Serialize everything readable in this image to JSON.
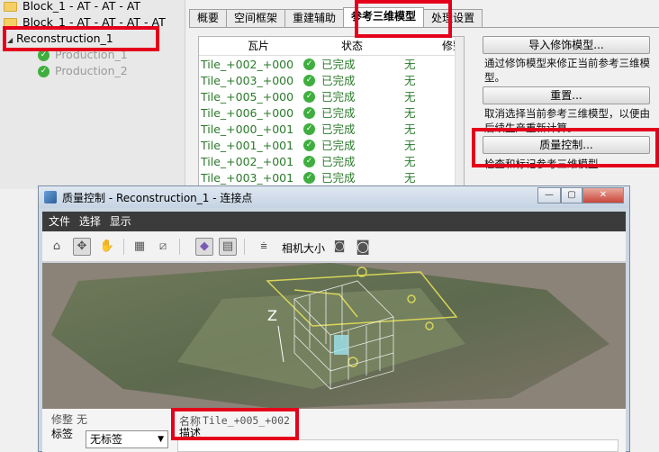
{
  "tree": {
    "items": [
      {
        "label": "Block_1 - AT - AT - AT"
      },
      {
        "label": "Block_1 - AT - AT - AT - AT"
      },
      {
        "label": "Reconstruction_1"
      },
      {
        "label": "Production_1"
      },
      {
        "label": "Production_2"
      }
    ]
  },
  "tabs": [
    {
      "label": "概要"
    },
    {
      "label": "空间框架"
    },
    {
      "label": "重建辅助"
    },
    {
      "label": "参考三维模型"
    },
    {
      "label": "处理设置"
    }
  ],
  "tiles": {
    "columns": [
      "瓦片",
      "状态",
      "修整"
    ],
    "rows": [
      {
        "tile": "Tile_+002_+000",
        "status": "已完成",
        "trim": "无"
      },
      {
        "tile": "Tile_+003_+000",
        "status": "已完成",
        "trim": "无"
      },
      {
        "tile": "Tile_+005_+000",
        "status": "已完成",
        "trim": "无"
      },
      {
        "tile": "Tile_+006_+000",
        "status": "已完成",
        "trim": "无"
      },
      {
        "tile": "Tile_+000_+001",
        "status": "已完成",
        "trim": "无"
      },
      {
        "tile": "Tile_+001_+001",
        "status": "已完成",
        "trim": "无"
      },
      {
        "tile": "Tile_+002_+001",
        "status": "已完成",
        "trim": "无"
      },
      {
        "tile": "Tile_+003_+001",
        "status": "已完成",
        "trim": "无"
      }
    ]
  },
  "actions": {
    "import_label": "导入修饰模型...",
    "import_desc": "通过修饰模型来修正当前参考三维模型。",
    "reset_label": "重置...",
    "reset_desc": "取消选择当前参考三维模型，以便由后续生产重新计算。",
    "qc_label": "质量控制...",
    "qc_desc": "检查和标记参考三维模型"
  },
  "dialog": {
    "title": "质量控制 - Reconstruction_1 - 连接点",
    "menu": [
      "文件",
      "选择",
      "显示"
    ],
    "toolbar": {
      "camera_size_label": "相机大小"
    },
    "axis_label": "Z",
    "trim_label": "修整",
    "trim_value": "无",
    "tag_label": "标签",
    "tag_value": "无标签",
    "name_label": "名称",
    "name_value": "Tile_+005_+002",
    "desc_label": "描述"
  },
  "colors": {
    "highlight": "#e4001b",
    "done_green": "#2a7a2a"
  }
}
